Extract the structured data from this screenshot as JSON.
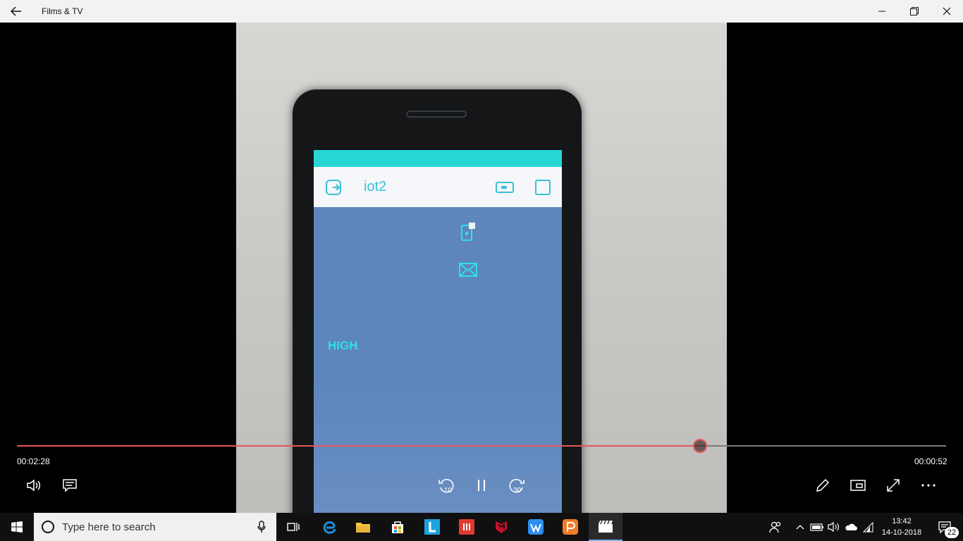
{
  "window": {
    "title": "Films & TV"
  },
  "video": {
    "app_title": "iot2",
    "label": "HIGH"
  },
  "player": {
    "elapsed": "00:02:28",
    "remaining": "00:00:52",
    "progress_fraction": 0.735,
    "controls": [
      "volume-icon",
      "subtitles-icon",
      "rewind-10-icon",
      "pause-icon",
      "forward-30-icon",
      "edit-icon",
      "mini-view-icon",
      "fullscreen-icon",
      "more-icon"
    ],
    "skip_back_label": "10",
    "skip_forward_label": "30"
  },
  "taskbar": {
    "search_placeholder": "Type here to search",
    "apps": [
      "task-view-icon",
      "edge-icon",
      "file-explorer-icon",
      "store-icon",
      "lens-app-icon",
      "red-app-icon",
      "mcafee-icon",
      "wps-writer-icon",
      "wps-presentation-icon",
      "films-tv-icon"
    ],
    "time": "13:42",
    "date": "14-10-2018",
    "notifications": "22"
  },
  "colors": {
    "accent": "#e8545a",
    "statusbar": "#27d7d6",
    "screen": "#5e86bd",
    "high_text": "#2fe0e6"
  }
}
